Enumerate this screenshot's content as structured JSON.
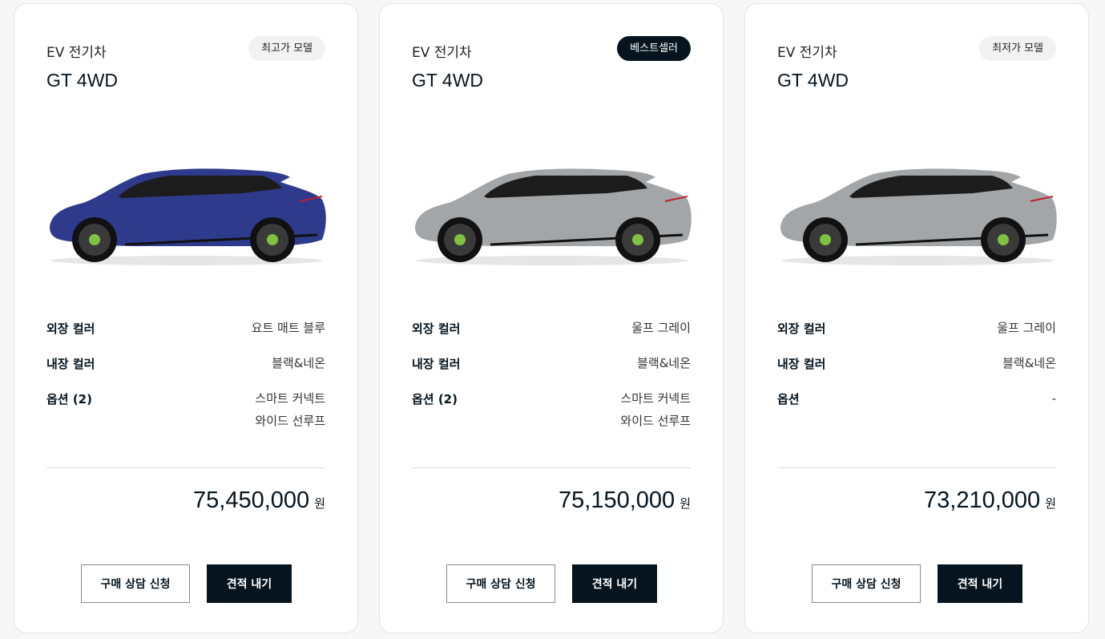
{
  "labels": {
    "exterior": "외장 컬러",
    "interior": "내장 컬러",
    "consult_button": "구매 상담 신청",
    "quote_button": "견적 내기",
    "currency_unit": "원"
  },
  "cards": [
    {
      "category": "EV 전기차",
      "model": "GT 4WD",
      "badge": "최고가 모델",
      "badge_style": "light",
      "car_color": "#2e3a8c",
      "exterior": "요트 매트 블루",
      "interior": "블랙&네온",
      "options_label": "옵션 (2)",
      "options": [
        "스마트 커넥트",
        "와이드 선루프"
      ],
      "price": "75,450,000"
    },
    {
      "category": "EV 전기차",
      "model": "GT 4WD",
      "badge": "베스트셀러",
      "badge_style": "dark",
      "car_color": "#a3a6a8",
      "exterior": "울프 그레이",
      "interior": "블랙&네온",
      "options_label": "옵션 (2)",
      "options": [
        "스마트 커넥트",
        "와이드 선루프"
      ],
      "price": "75,150,000"
    },
    {
      "category": "EV 전기차",
      "model": "GT 4WD",
      "badge": "최저가 모델",
      "badge_style": "light",
      "car_color": "#a3a6a8",
      "exterior": "울프 그레이",
      "interior": "블랙&네온",
      "options_label": "옵션",
      "options": [
        "-",
        ""
      ],
      "price": "73,210,000"
    }
  ]
}
